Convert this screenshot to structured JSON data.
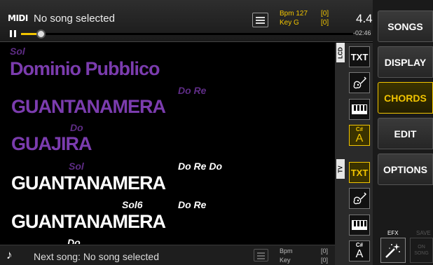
{
  "topbar": {
    "logo": "MIDI",
    "song_title": "No song selected",
    "bpm_label": "Bpm 127",
    "key_label": "Key G",
    "bpm_offset": "[0]",
    "key_offset": "[0]",
    "time_signature": "4.4",
    "time_remaining": "-02:46",
    "progress": 0.06
  },
  "lyrics": [
    {
      "chord": "Sol",
      "text": "Dominio Pubblico"
    },
    {
      "chord": "Do Re",
      "text": "GUANTANAMERA"
    },
    {
      "chord": "Do",
      "text": "GUAJIRA"
    },
    {
      "chord_a": "Sol",
      "chord_b": "Do Re Do",
      "text": "GUANTANAMERA"
    },
    {
      "chord_a": "Sol6",
      "chord_b": "Do Re",
      "text": "GUANTANAMERA"
    },
    {
      "chord": "Do"
    }
  ],
  "bottombar": {
    "next_song": "Next song: No song selected",
    "bpm_label": "Bpm",
    "key_label": "Key",
    "bpm_offset": "[0]",
    "key_offset": "[0]"
  },
  "tools": {
    "lcd_tab": "LCD",
    "tv_tab": "TV",
    "txt_label": "TXT",
    "key_sharp": "C#",
    "key_natural": "A"
  },
  "nav": {
    "songs": "SONGS",
    "display": "DISPLAY",
    "chords": "CHORDS",
    "edit": "EDIT",
    "options": "OPTIONS",
    "efx": "EFX",
    "save": "SAVE",
    "on_song_line1": "ON",
    "on_song_line2": "SONG"
  },
  "icons": {
    "list": "list-icon",
    "pause": "pause-icon",
    "note": "music-note-icon",
    "guitar": "guitar-icon",
    "piano": "piano-icon",
    "wand": "magic-wand-icon"
  },
  "colors": {
    "accent": "#f2c500",
    "past_lyric": "#7b3cae",
    "current_lyric": "#ffffff"
  }
}
